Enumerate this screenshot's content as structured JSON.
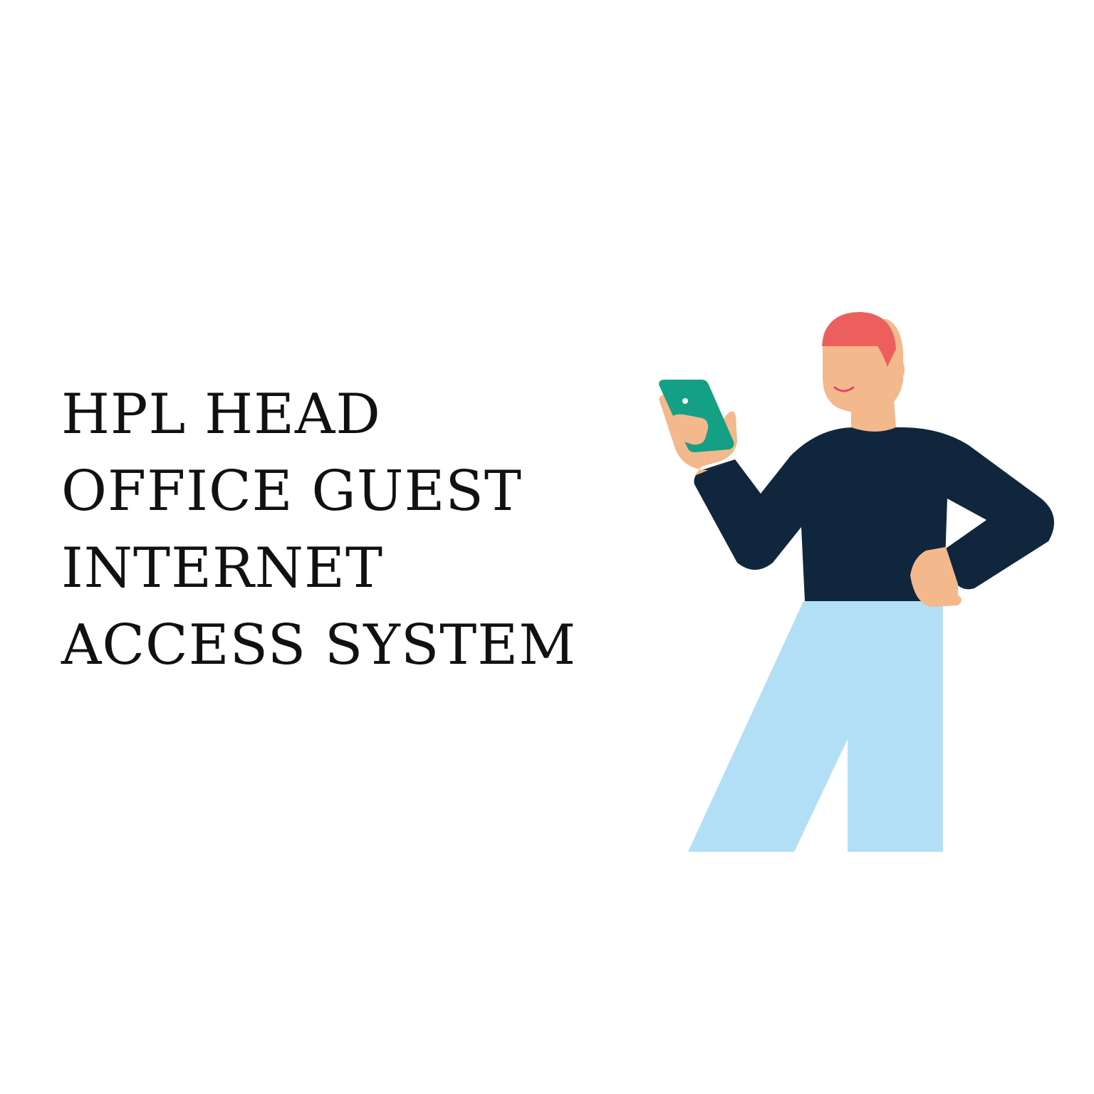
{
  "title": {
    "lines": [
      "HPL HEAD",
      "OFFICE GUEST",
      "INTERNET",
      "ACCESS SYSTEM"
    ]
  },
  "illustration": {
    "icon": "person-with-phone-illustration",
    "colors": {
      "hair": "#ec5f5c",
      "skin": "#f3b88c",
      "sweater": "#10263d",
      "pants": "#b3dff6",
      "phone": "#13a085"
    }
  }
}
